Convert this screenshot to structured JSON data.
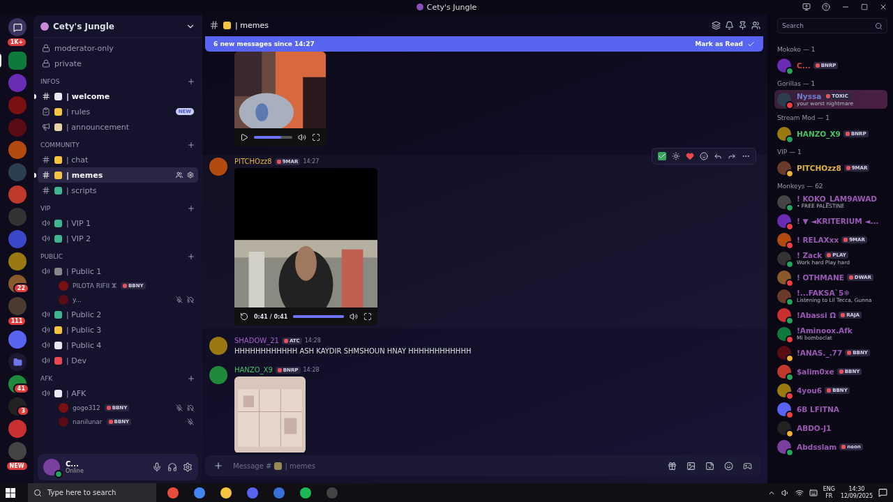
{
  "window": {
    "title": "Cety's Jungle"
  },
  "servers": [
    {
      "kind": "home",
      "badge": "1K+",
      "selected": false
    },
    {
      "kind": "server",
      "selected": true
    },
    {
      "kind": "server",
      "selected": false
    },
    {
      "kind": "server",
      "selected": false
    },
    {
      "kind": "server",
      "selected": false
    },
    {
      "kind": "server",
      "selected": false
    },
    {
      "kind": "server",
      "selected": false
    },
    {
      "kind": "server",
      "selected": false
    },
    {
      "kind": "server",
      "selected": false
    },
    {
      "kind": "server",
      "selected": false
    },
    {
      "kind": "server",
      "selected": false
    },
    {
      "kind": "server",
      "badge": "22",
      "selected": false
    },
    {
      "kind": "server",
      "badge": "111",
      "selected": false
    },
    {
      "kind": "server",
      "selected": false
    },
    {
      "kind": "folder",
      "selected": false
    },
    {
      "kind": "server",
      "badge": "41",
      "selected": false
    },
    {
      "kind": "server",
      "badge": "3",
      "selected": false
    },
    {
      "kind": "server",
      "selected": false
    },
    {
      "kind": "server",
      "badge": "NEW",
      "selected": false
    }
  ],
  "sidebar": {
    "server_name": "Cety's Jungle",
    "sections": [
      {
        "channels": [
          {
            "kind": "locked",
            "name": "moderator-only",
            "emoji": false,
            "selected": false,
            "unread": false
          },
          {
            "kind": "locked",
            "name": "private",
            "emoji": false,
            "selected": false,
            "unread": false
          }
        ]
      },
      {
        "title": "INFOS",
        "channels": [
          {
            "kind": "text",
            "name": "| welcome",
            "emoji": true,
            "selected": false,
            "unread": true
          },
          {
            "kind": "rules",
            "name": "| rules",
            "emoji": true,
            "badge": "NEW",
            "selected": false,
            "unread": false
          },
          {
            "kind": "announce",
            "name": "| announcement",
            "emoji": true,
            "selected": false,
            "unread": false
          }
        ]
      },
      {
        "title": "COMMUNITY",
        "channels": [
          {
            "kind": "text",
            "name": "| chat",
            "emoji": true,
            "selected": false,
            "unread": false
          },
          {
            "kind": "text",
            "name": "| memes",
            "emoji": true,
            "selected": true,
            "unread": true
          },
          {
            "kind": "text",
            "name": "| scripts",
            "emoji": true,
            "selected": false,
            "unread": false
          }
        ]
      },
      {
        "title": "VIP",
        "channels": [
          {
            "kind": "voice",
            "name": "| VIP 1",
            "emoji": true,
            "selected": false,
            "unread": false
          },
          {
            "kind": "voice",
            "name": "| VIP 2",
            "emoji": true,
            "selected": false,
            "unread": false
          }
        ]
      },
      {
        "title": "PUBLIC",
        "channels": [
          {
            "kind": "voice",
            "name": "| Public 1",
            "emoji": true,
            "selected": false,
            "unread": false,
            "members": [
              {
                "name": "PILOTA RIFII ⵣ",
                "tag": "BBNY",
                "muted": false,
                "deafened": false
              },
              {
                "name": "y...",
                "muted": true,
                "deafened": true
              }
            ]
          },
          {
            "kind": "voice",
            "name": "| Public 2",
            "emoji": true,
            "selected": false,
            "unread": false
          },
          {
            "kind": "voice",
            "name": "| Public 3",
            "emoji": true,
            "selected": false,
            "unread": false
          },
          {
            "kind": "voice",
            "name": "| Public 4",
            "emoji": true,
            "selected": false,
            "unread": false
          },
          {
            "kind": "voice",
            "name": "| Dev",
            "emoji": true,
            "selected": false,
            "unread": false
          }
        ]
      },
      {
        "title": "AFK",
        "channels": [
          {
            "kind": "voice",
            "name": "| AFK",
            "emoji": true,
            "selected": false,
            "unread": false,
            "members": [
              {
                "name": "gogo312",
                "tag": "BBNY",
                "muted": true,
                "deafened": true
              },
              {
                "name": "nanilunar",
                "tag": "BBNY",
                "muted": true,
                "deafened": false
              }
            ]
          }
        ]
      }
    ]
  },
  "user_panel": {
    "name": "C...",
    "status": "Online"
  },
  "chat": {
    "channel": "| memes",
    "banner": {
      "text": "6 new messages since 14:27",
      "action": "Mark as Read"
    },
    "messages": [
      {
        "kind": "video",
        "continued": true,
        "level": 0.7
      },
      {
        "kind": "video",
        "author": "PITCHOzz8",
        "color": "#e2b53c",
        "tag": "9MAR",
        "time": "14:27",
        "time_code": "0:41 / 0:41",
        "level": 1,
        "hovered": true
      },
      {
        "kind": "text",
        "author": "SHADOW_21",
        "color": "#a35fd0",
        "tag": "ATC",
        "time": "14:28",
        "text": "HHHHHHHHHHHH ASH KAYDIR SHMSHOUN HNAY HHHHHHHHHHHH"
      },
      {
        "author": "HANZO_X9",
        "color": "#43c464",
        "tag": "BNRP",
        "time": "14:28"
      }
    ],
    "composer": {
      "prefix": "Message #",
      "suffix": "| memes"
    }
  },
  "search": {
    "placeholder": "Search"
  },
  "member_groups": [
    {
      "title": "Mokoko — 1",
      "color": "#d0463a",
      "members": [
        {
          "name": "C...",
          "tag": "BNRP",
          "color": "#23a55a"
        }
      ]
    },
    {
      "title": "Gorillas — 1",
      "color": "#6f7fc9",
      "members": [
        {
          "name": "Nyssa",
          "tag": "TOXIC",
          "activity": "your worst nightmare",
          "color": "#f23f43",
          "highlighted": true
        }
      ]
    },
    {
      "title": "Stream Mod — 1",
      "color": "#43c464",
      "members": [
        {
          "name": "HANZO_X9",
          "tag": "BNRP",
          "color": "#23a55a"
        }
      ]
    },
    {
      "title": "VIP — 1",
      "color": "#e2b53c",
      "members": [
        {
          "name": "PITCHOzz8",
          "tag": "9MAR",
          "color": "#f0b232"
        }
      ]
    },
    {
      "title": "Monkeys — 62",
      "color": "#9b59b6",
      "members": [
        {
          "name": "! KOKO_LAM9AWAD",
          "activity": "• FREE PALESTINE",
          "color": "#23a55a"
        },
        {
          "name": "! ▼ ◄KRITERIUM ◄...",
          "color": "#f23f43"
        },
        {
          "name": "! RELAXxx",
          "tag": "9MAR",
          "color": "#f23f43"
        },
        {
          "name": "! Zack",
          "tag": "PLAY",
          "activity": "Work hard Play hard",
          "color": "#23a55a"
        },
        {
          "name": "! OTHMANE",
          "tag": "DWAR",
          "color": "#f23f43"
        },
        {
          "name": "!...FAKSA`5❄",
          "activity": "Listening to Lil Tecca, Gunna",
          "color": "#23a55a"
        },
        {
          "name": "!Abassi Ω",
          "tag": "RAJA",
          "color": "#23a55a"
        },
        {
          "name": "!Aminoox.Afk",
          "activity": "Mi bomboclat",
          "color": "#f23f43"
        },
        {
          "name": "!ANAS._.77",
          "tag": "BBNY",
          "color": "#f0b232"
        },
        {
          "name": "$alim0xe",
          "tag": "BBNY",
          "color": "#23a55a"
        },
        {
          "name": "4you6",
          "tag": "BBNY",
          "color": "#f23f43"
        },
        {
          "name": "6B LFITNA",
          "color": "#f23f43"
        },
        {
          "name": "ABDO-J1",
          "color": "#f0b232"
        },
        {
          "name": "Abdsslam",
          "tag": "neon",
          "color": "#23a55a"
        }
      ]
    }
  ],
  "taskbar": {
    "search_placeholder": "Type here to search",
    "languages": [
      "ENG",
      "FR"
    ],
    "time": "14:30",
    "date": "12/09/2025"
  }
}
